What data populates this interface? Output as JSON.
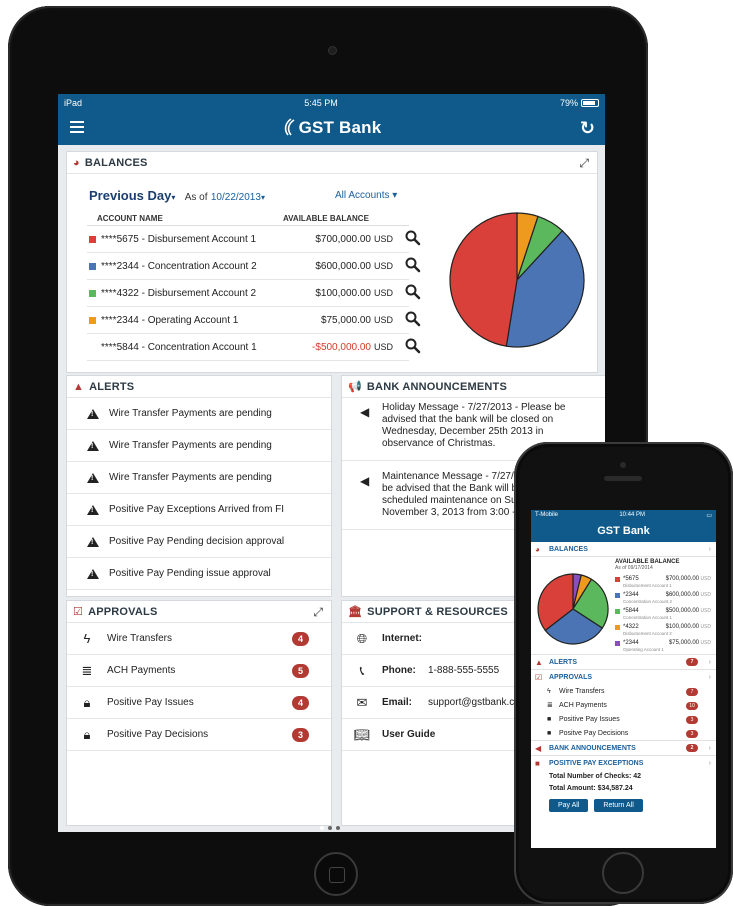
{
  "ipad": {
    "status": {
      "device": "iPad",
      "time": "5:45 PM",
      "battery": "79%"
    },
    "nav": {
      "brand": "GST Bank"
    },
    "balances": {
      "title": "BALANCES",
      "period": "Previous Day",
      "as_of_label": "As of",
      "as_of_date": "10/22/2013",
      "account_filter": "All Accounts",
      "col_account": "ACCOUNT NAME",
      "col_balance": "AVAILABLE BALANCE",
      "rows": [
        {
          "name": "****5675 - Disbursement Account 1",
          "amount": "$700,000.00",
          "currency": "USD",
          "color": "#d9403a"
        },
        {
          "name": "****2344 - Concentration Account 2",
          "amount": "$600,000.00",
          "currency": "USD",
          "color": "#4a74b4"
        },
        {
          "name": "****4322 - Disbursement Account 2",
          "amount": "$100,000.00",
          "currency": "USD",
          "color": "#5cb85c"
        },
        {
          "name": "****2344 - Operating Account 1",
          "amount": "$75,000.00",
          "currency": "USD",
          "color": "#ee9a1e"
        },
        {
          "name": "****5844 - Concentration Account 1",
          "amount": "-$500,000.00",
          "currency": "USD",
          "color": ""
        }
      ]
    },
    "alerts": {
      "title": "ALERTS",
      "items": [
        "Wire Transfer Payments are pending",
        "Wire Transfer Payments are pending",
        "Wire Transfer Payments are pending",
        "Positive Pay Exceptions Arrived from FI",
        "Positive Pay Pending decision approval",
        "Positive Pay Pending issue approval"
      ]
    },
    "announcements": {
      "title": "BANK ANNOUNCEMENTS",
      "items": [
        {
          "line1": "Holiday Message - 7/27/2013 - Please be",
          "line2": "advised that the bank will be closed on",
          "line3": "Wednesday, December 25th 2013 in",
          "line4": "observance of Christmas."
        },
        {
          "line1": "Maintenance Message - 7/27/2",
          "line2": "be advised that the Bank will b",
          "line3": "scheduled maintenance on Sun",
          "line4": "November 3, 2013 from 3:00 -"
        }
      ]
    },
    "approvals": {
      "title": "APPROVALS",
      "items": [
        {
          "label": "Wire Transfers",
          "count": "4"
        },
        {
          "label": "ACH Payments",
          "count": "5"
        },
        {
          "label": "Positive Pay Issues",
          "count": "4"
        },
        {
          "label": "Positive Pay Decisions",
          "count": "3"
        }
      ]
    },
    "support": {
      "title": "SUPPORT & RESOURCES",
      "internet_label": "Internet:",
      "phone_label": "Phone:",
      "phone_value": "1-888-555-5555",
      "email_label": "Email:",
      "email_value": "support@gstbank.com",
      "guide_label": "User Guide"
    }
  },
  "iphone": {
    "status": {
      "carrier": "T-Mobile",
      "time": "10:44 PM"
    },
    "nav": {
      "brand": "GST Bank"
    },
    "balances": {
      "title": "BALANCES",
      "avail_title": "AVAILABLE BALANCE",
      "as_of": "As of 09/17/2014",
      "rows": [
        {
          "acct": "*5675",
          "desc": "Disbursement Account 1",
          "amount": "$700,000.00",
          "cur": "USD",
          "color": "#d9403a"
        },
        {
          "acct": "*2344",
          "desc": "Concentration Account 2",
          "amount": "$600,000.00",
          "cur": "USD",
          "color": "#4a74b4"
        },
        {
          "acct": "*5844",
          "desc": "Concentration Account 1",
          "amount": "$500,000.00",
          "cur": "USD",
          "color": "#5cb85c"
        },
        {
          "acct": "*4322",
          "desc": "Disbursement Account 2",
          "amount": "$100,000.00",
          "cur": "USD",
          "color": "#ee9a1e"
        },
        {
          "acct": "*2344",
          "desc": "Operating Account 1",
          "amount": "$75,000.00",
          "cur": "USD",
          "color": "#8a4fbf"
        }
      ]
    },
    "alerts": {
      "title": "ALERTS",
      "count": "7"
    },
    "approvals": {
      "title": "APPROVALS",
      "items": [
        {
          "label": "Wire Transfers",
          "count": "7"
        },
        {
          "label": "ACH Payments",
          "count": "10"
        },
        {
          "label": "Positive Pay Issues",
          "count": "3"
        },
        {
          "label": "Positve Pay Decisions",
          "count": "3"
        }
      ]
    },
    "announcements": {
      "title": "BANK ANNOUNCEMENTS",
      "count": "2"
    },
    "positive_pay": {
      "title": "POSITIVE PAY EXCEPTIONS",
      "checks": "Total Number of Checks: 42",
      "amount": "Total Amount: $34,587.24",
      "pay_all": "Pay All",
      "return_all": "Return All"
    }
  }
}
